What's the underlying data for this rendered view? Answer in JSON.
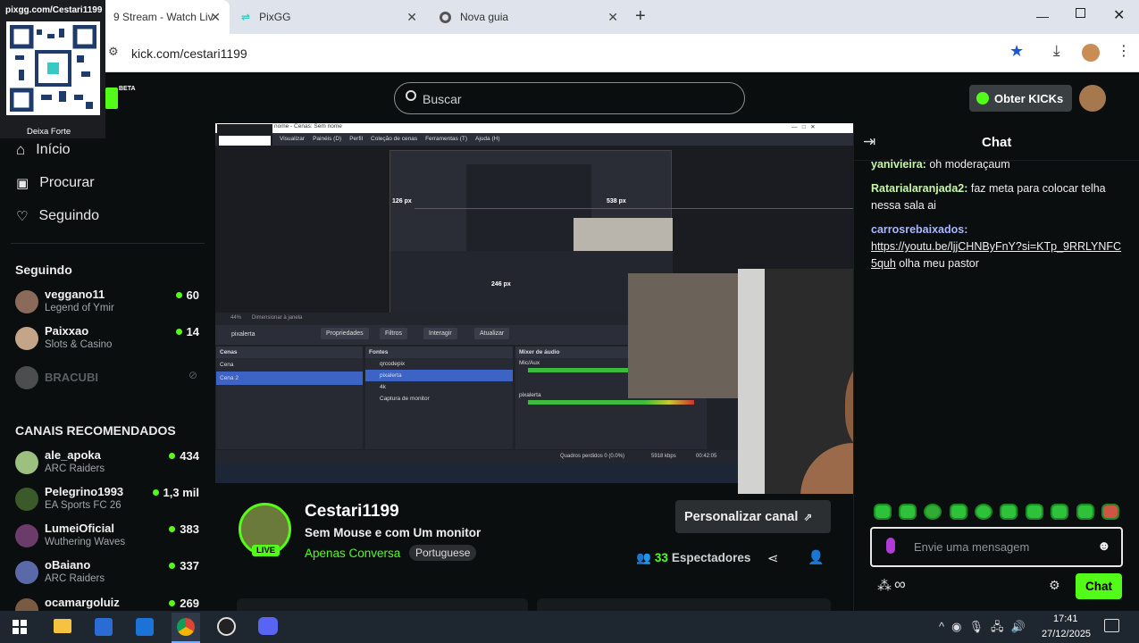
{
  "browser": {
    "tabs": [
      {
        "label": "9 Stream - Watch Liv"
      },
      {
        "label": "PixGG"
      },
      {
        "label": "Nova guia"
      }
    ],
    "url": "kick.com/cestari1199",
    "new_tab": "+"
  },
  "overlay": {
    "qr_url": "pixgg.com/Cestari1199",
    "qr_caption": "Deixa Forte",
    "beta": "BETA"
  },
  "header": {
    "search_placeholder": "Buscar",
    "get_kicks": "Obter KICKs"
  },
  "sidebar": {
    "nav": [
      {
        "label": "Início"
      },
      {
        "label": "Procurar"
      },
      {
        "label": "Seguindo"
      }
    ],
    "following_title": "Seguindo",
    "following": [
      {
        "name": "veggano11",
        "game": "Legend of Ymir",
        "viewers": "60"
      },
      {
        "name": "Paixxao",
        "game": "Slots & Casino",
        "viewers": "14"
      },
      {
        "name": "BRACUBI",
        "game": "",
        "viewers": ""
      }
    ],
    "recommended_title": "CANAIS RECOMENDADOS",
    "recommended": [
      {
        "name": "ale_apoka",
        "game": "ARC Raiders",
        "viewers": "434"
      },
      {
        "name": "Pelegrino1993",
        "game": "EA Sports FC 26",
        "viewers": "1,3 mil"
      },
      {
        "name": "LumeiOficial",
        "game": "Wuthering Waves",
        "viewers": "383"
      },
      {
        "name": "oBaiano",
        "game": "ARC Raiders",
        "viewers": "337"
      },
      {
        "name": "ocamargoluiz",
        "game": "",
        "viewers": "269"
      }
    ]
  },
  "stream": {
    "obs_menu": [
      "Visualizar",
      "Painéis (D)",
      "Perfil",
      "Coleção de cenas",
      "Ferramentas (T)",
      "Ajuda (H)"
    ],
    "obs_title": "nome - Cenas: Sem nome",
    "obs_source": "pixalerta",
    "obs_buttons": [
      "Propriedades",
      "Filtros",
      "Interagir",
      "Atualizar"
    ],
    "obs_panels": {
      "scenes": "Cenas",
      "sources": "Fontes",
      "mixer": "Mixer de áudio"
    },
    "obs_scenes": [
      "Cena",
      "Cena 2"
    ],
    "obs_sources": [
      "qrcodepix",
      "pixalerta",
      "4k",
      "Captura de monitor"
    ],
    "obs_mixer": [
      "Mic/Aux",
      "pixalerta"
    ],
    "obs_status": "Quadros perdidos 0 (0.0%)",
    "obs_kbps": "5918 kbps",
    "obs_time": "00:42:05",
    "obs_dims": [
      "126 px",
      "538 px",
      "246 px"
    ],
    "obs_zoom": "44%",
    "obs_resize": "Dimensionar à janela"
  },
  "channel": {
    "name": "Cestari1199",
    "title": "Sem Mouse e com Um monitor",
    "category": "Apenas Conversa",
    "tag": "Portuguese",
    "live": "LIVE",
    "viewers_count": "33",
    "viewers_label": "Espectadores",
    "customize": "Personalizar canal"
  },
  "chat": {
    "title": "Chat",
    "messages": [
      {
        "user": "yanivieira:",
        "text": " oh moderaçaum"
      },
      {
        "user": "Ratarialaranjada2:",
        "text": " faz meta para colocar telha nessa sala ai"
      },
      {
        "user": "carrosrebaixados:",
        "text": ""
      }
    ],
    "link": "https://youtu.be/ljjCHNByFnY?si=KTp_9RRLYNFC5quh",
    "link_suffix": " olha meu pastor",
    "input_placeholder": "Envie uma mensagem",
    "send": "Chat",
    "infinity": "∞"
  },
  "taskbar": {
    "time": "17:41",
    "date": "27/12/2025"
  },
  "colors": {
    "accent": "#53fc18",
    "background": "#0b0e0f",
    "chat_user": "#c7f7a6",
    "link": "#cfd8ff"
  }
}
